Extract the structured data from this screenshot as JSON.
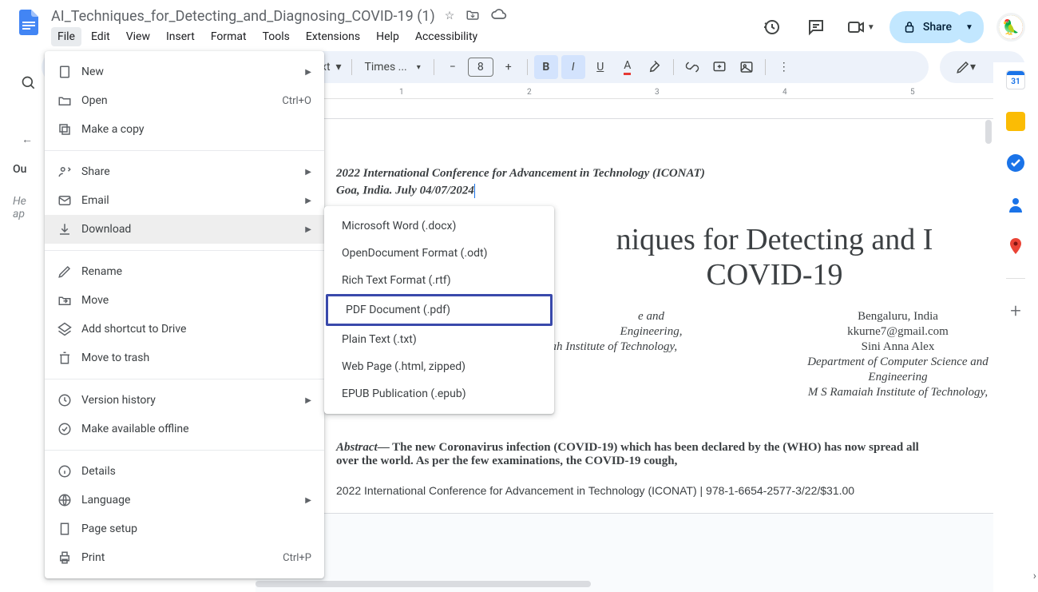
{
  "doc_title": "AI_Techniques_for_Detecting_and_Diagnosing_COVID-19 (1)",
  "menus": {
    "file": "File",
    "edit": "Edit",
    "view": "View",
    "insert": "Insert",
    "format": "Format",
    "tools": "Tools",
    "extensions": "Extensions",
    "help": "Help",
    "accessibility": "Accessibility"
  },
  "toolbar": {
    "style_label": "xt",
    "font_name": "Times ...",
    "font_size": "8"
  },
  "share_label": "Share",
  "calendar_day": "31",
  "file_menu": {
    "new": "New",
    "open": "Open",
    "open_shortcut": "Ctrl+O",
    "make_copy": "Make a copy",
    "share": "Share",
    "email": "Email",
    "download": "Download",
    "rename": "Rename",
    "move": "Move",
    "add_shortcut": "Add shortcut to Drive",
    "move_trash": "Move to trash",
    "version_history": "Version history",
    "offline": "Make available offline",
    "details": "Details",
    "language": "Language",
    "page_setup": "Page setup",
    "print": "Print",
    "print_shortcut": "Ctrl+P"
  },
  "download_menu": {
    "docx": "Microsoft Word (.docx)",
    "odt": "OpenDocument Format (.odt)",
    "rtf": "Rich Text Format (.rtf)",
    "pdf": "PDF Document (.pdf)",
    "txt": "Plain Text (.txt)",
    "html": "Web Page (.html, zipped)",
    "epub": "EPUB Publication (.epub)"
  },
  "outline": {
    "heading": "Ou",
    "text1": "He",
    "text2": "ap"
  },
  "ruler": {
    "t1": "1",
    "t2": "2",
    "t3": "3",
    "t4": "4",
    "t5": "5"
  },
  "document": {
    "conf": "2022 International Conference for Advancement in Technology (ICONAT)",
    "loc": "Goa, India. July 04/07/2024",
    "title_line1": "niques for Detecting and I",
    "title_line2": "COVID-19",
    "author1_loc": "e and",
    "author1_dept2": "Engineering,",
    "author1_inst": "M S Ramaiah Institute of Technology,",
    "author2_loc": "Bengaluru, India",
    "author2_email": "kkurne7@gmail.com",
    "author2_name": "Sini Anna Alex",
    "author2_dept1": "Department of Computer Science and",
    "author2_dept2": "Engineering",
    "author2_inst": "M S Ramaiah Institute of Technology,",
    "abstract_label": "Abstract",
    "abstract_text": "— The new Coronavirus infection (COVID-19)  which has been declared by the  (WHO) has now spread all over the world. As per the few  examinations, the COVID-19  cough,",
    "footer": "2022 International Conference for Advancement in Technology (ICONAT) | 978-1-6654-2577-3/22/$31.00"
  }
}
